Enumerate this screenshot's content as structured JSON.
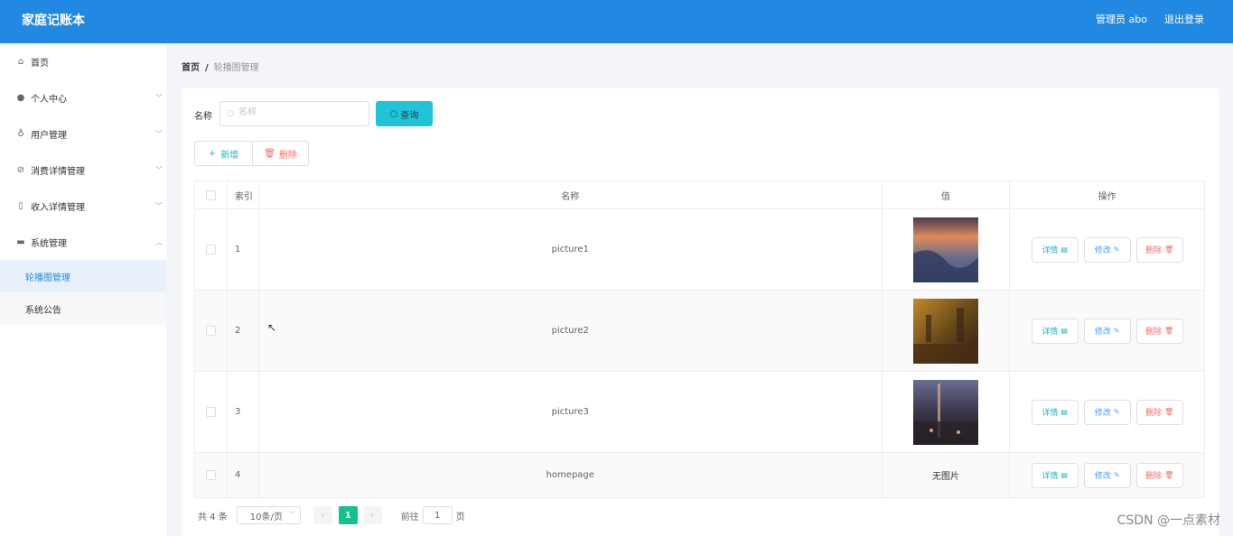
{
  "header": {
    "title": "家庭记账本",
    "user": "管理员 abo",
    "logout": "退出登录"
  },
  "sidebar": {
    "items": [
      {
        "label": "首页",
        "icon": "home-icon"
      },
      {
        "label": "个人中心",
        "icon": "user-icon"
      },
      {
        "label": "用户管理",
        "icon": "mic-icon"
      },
      {
        "label": "消费详情管理",
        "icon": "bell-off-icon"
      },
      {
        "label": "收入详情管理",
        "icon": "phone-icon"
      },
      {
        "label": "系统管理",
        "icon": "monitor-icon"
      }
    ],
    "submenu": [
      {
        "label": "轮播图管理",
        "active": true
      },
      {
        "label": "系统公告",
        "active": false
      }
    ]
  },
  "breadcrumb": {
    "home": "首页",
    "separator": "/",
    "current": "轮播图管理"
  },
  "search": {
    "label": "名称",
    "placeholder": "名称",
    "button": "查询"
  },
  "actions": {
    "add": "新增",
    "delete": "删除"
  },
  "table": {
    "headers": {
      "index": "索引",
      "name": "名称",
      "value": "值",
      "ops": "操作"
    },
    "rows": [
      {
        "index": "1",
        "name": "picture1",
        "value": "",
        "has_image": true
      },
      {
        "index": "2",
        "name": "picture2",
        "value": "",
        "has_image": true
      },
      {
        "index": "3",
        "name": "picture3",
        "value": "",
        "has_image": true
      },
      {
        "index": "4",
        "name": "homepage",
        "value": "无图片",
        "has_image": false
      }
    ],
    "ops": {
      "detail": "详情",
      "edit": "修改",
      "remove": "删除"
    }
  },
  "pagination": {
    "total": "共 4 条",
    "page_size": "10条/页",
    "current_page": "1",
    "goto_prefix": "前往",
    "goto_value": "1",
    "goto_suffix": "页"
  },
  "watermark": "CSDN @一点素材",
  "colors": {
    "header": "#2289e3",
    "query": "#1fc4d8",
    "page_active": "#13c08f",
    "danger": "#f56c6c"
  }
}
